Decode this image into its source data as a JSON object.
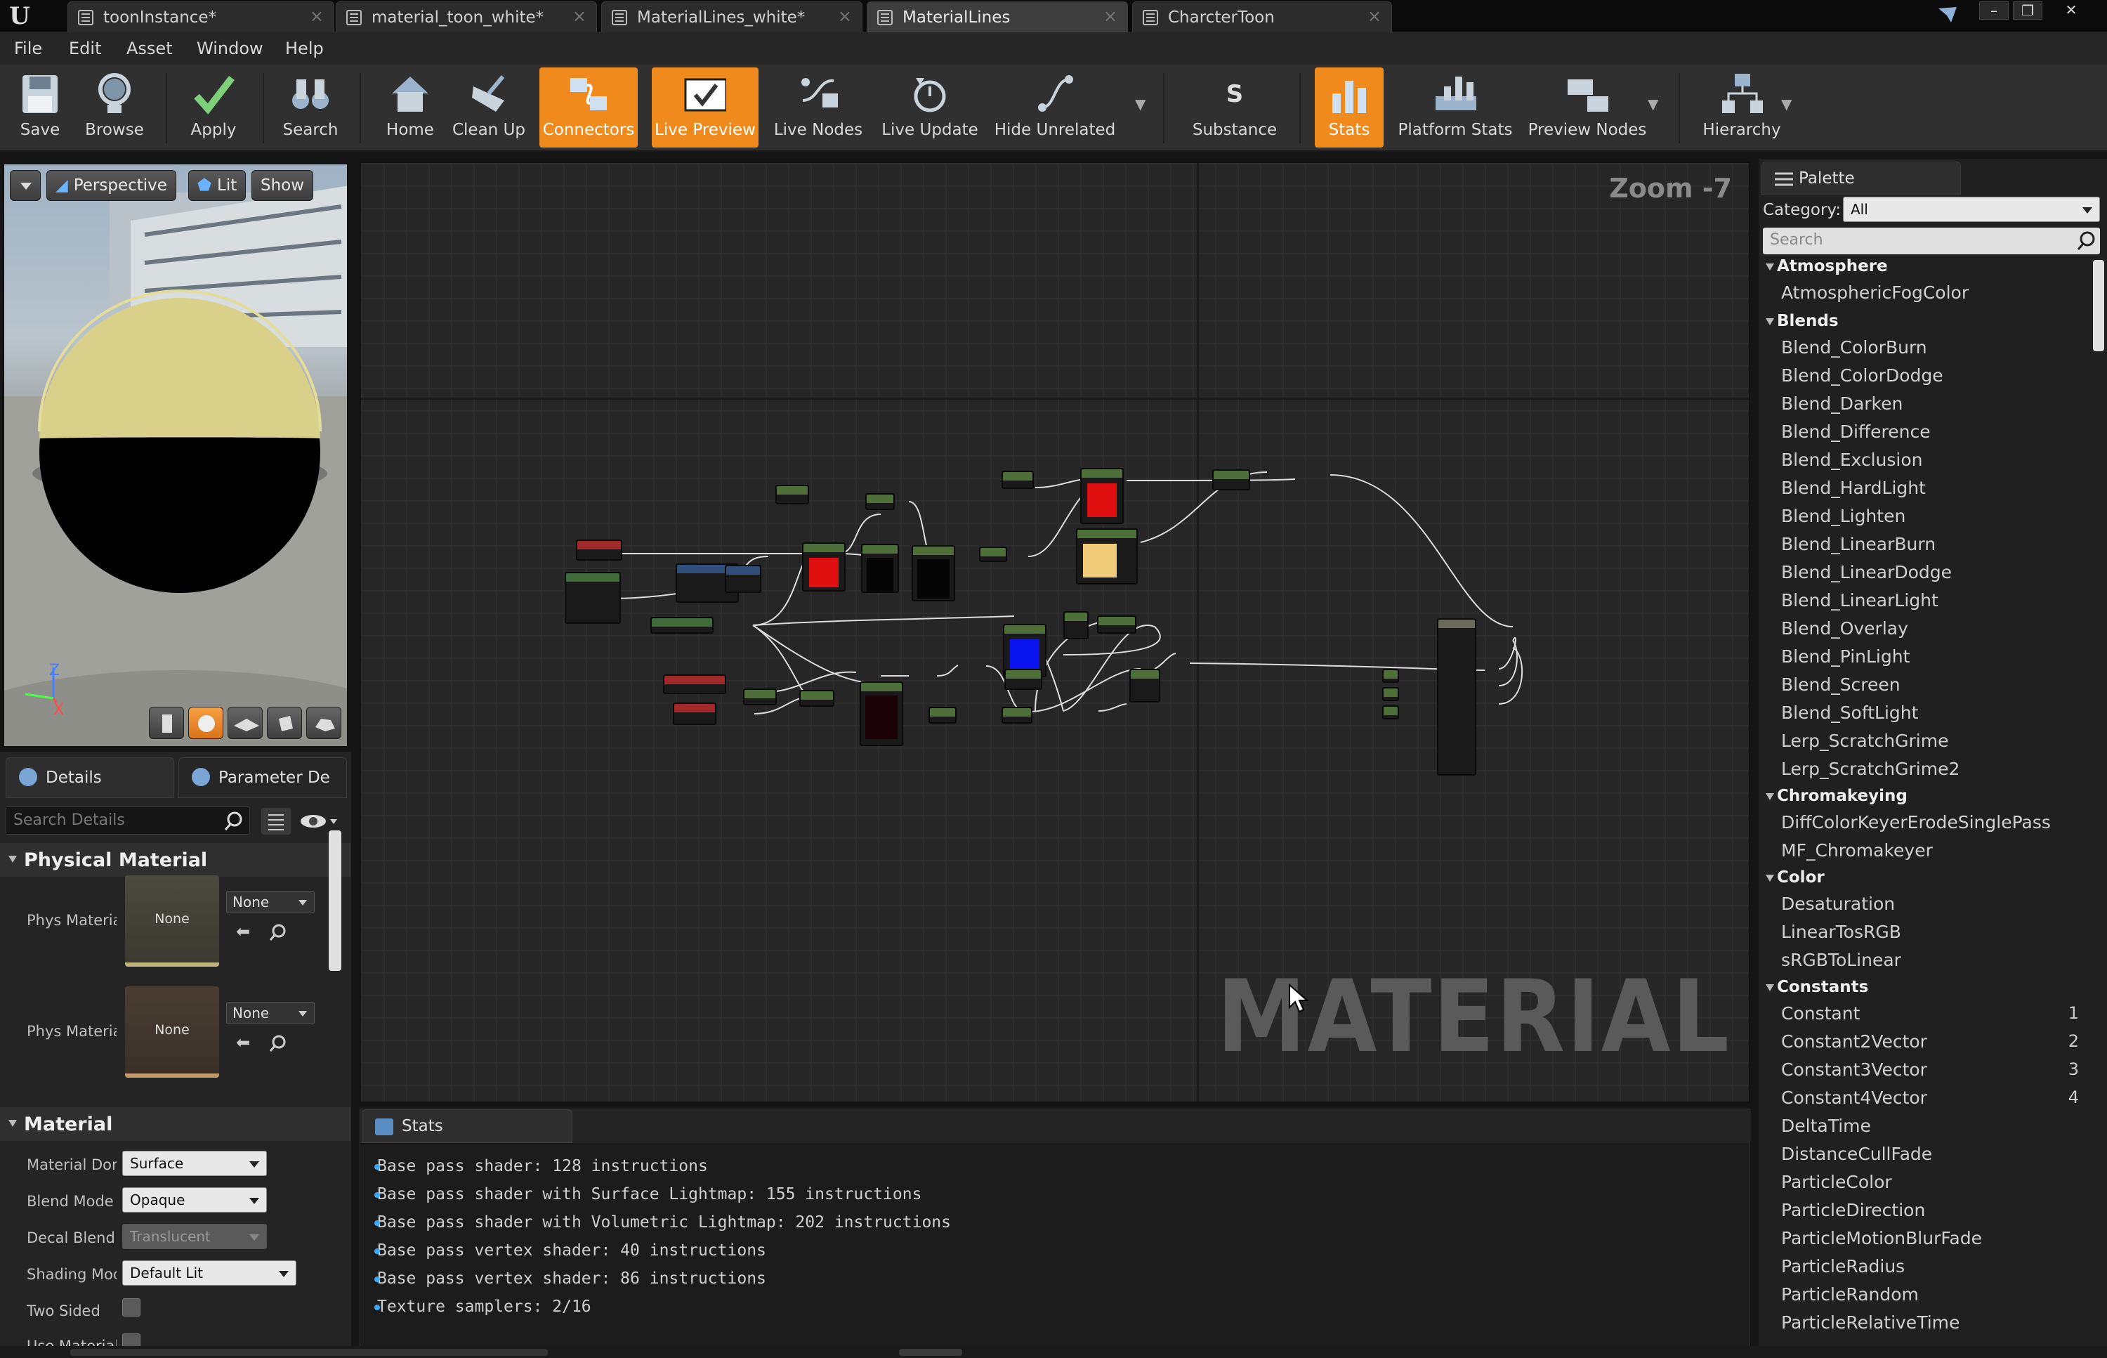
{
  "window": {
    "tabs": [
      {
        "label": "toonInstance*"
      },
      {
        "label": "material_toon_white*"
      },
      {
        "label": "MaterialLines_white*"
      },
      {
        "label": "MaterialLines"
      },
      {
        "label": "CharcterToon"
      }
    ]
  },
  "menu": [
    "File",
    "Edit",
    "Asset",
    "Window",
    "Help"
  ],
  "toolbar": {
    "save": "Save",
    "browse": "Browse",
    "apply": "Apply",
    "search": "Search",
    "home": "Home",
    "clean_up": "Clean Up",
    "connectors": "Connectors",
    "live_preview": "Live Preview",
    "live_nodes": "Live Nodes",
    "live_update": "Live Update",
    "hide_unrelated": "Hide Unrelated",
    "substance": "Substance",
    "stats": "Stats",
    "platform_stats": "Platform Stats",
    "preview_nodes": "Preview Nodes",
    "hierarchy": "Hierarchy",
    "accent": "#f08a1c"
  },
  "viewport": {
    "perspective": "Perspective",
    "lit": "Lit",
    "show": "Show",
    "axis_z": "Z",
    "axis_x": "X"
  },
  "details": {
    "tab_details": "Details",
    "tab_params": "Parameter De",
    "search_placeholder": "Search Details",
    "physical_material": {
      "title": "Physical Material",
      "rows": [
        {
          "label": "Phys Material",
          "swatch": "None",
          "value": "None"
        },
        {
          "label": "Phys Material",
          "swatch": "None",
          "value": "None"
        }
      ]
    },
    "material": {
      "title": "Material",
      "material_domain_label": "Material Dom",
      "material_domain": "Surface",
      "blend_mode_label": "Blend Mode",
      "blend_mode": "Opaque",
      "decal_blend_label": "Decal Blend M",
      "decal_blend": "Translucent",
      "shading_model_label": "Shading Mod",
      "shading_model": "Default Lit",
      "two_sided_label": "Two Sided",
      "use_material_label": "Use Material A"
    }
  },
  "graph": {
    "zoom": "Zoom -7",
    "watermark": "MATERIAL"
  },
  "stats": {
    "tab": "Stats",
    "lines": [
      "Base pass shader: 128 instructions",
      "Base pass shader with Surface Lightmap: 155 instructions",
      "Base pass shader with Volumetric Lightmap: 202 instructions",
      "Base pass vertex shader: 40 instructions",
      "Base pass vertex shader: 86 instructions",
      "Texture samplers: 2/16"
    ]
  },
  "palette": {
    "tab": "Palette",
    "category_label": "Category:",
    "category_value": "All",
    "search_placeholder": "Search",
    "groups": [
      {
        "name": "Atmosphere",
        "items": [
          "AtmosphericFogColor"
        ]
      },
      {
        "name": "Blends",
        "items": [
          "Blend_ColorBurn",
          "Blend_ColorDodge",
          "Blend_Darken",
          "Blend_Difference",
          "Blend_Exclusion",
          "Blend_HardLight",
          "Blend_Lighten",
          "Blend_LinearBurn",
          "Blend_LinearDodge",
          "Blend_LinearLight",
          "Blend_Overlay",
          "Blend_PinLight",
          "Blend_Screen",
          "Blend_SoftLight",
          "Lerp_ScratchGrime",
          "Lerp_ScratchGrime2"
        ]
      },
      {
        "name": "Chromakeying",
        "items": [
          "DiffColorKeyerErodeSinglePass",
          "MF_Chromakeyer"
        ]
      },
      {
        "name": "Color",
        "items": [
          "Desaturation",
          "LinearTosRGB",
          "sRGBToLinear"
        ]
      },
      {
        "name": "Constants",
        "items": [
          "Constant",
          "Constant2Vector",
          "Constant3Vector",
          "Constant4Vector",
          "DeltaTime",
          "DistanceCullFade",
          "ParticleColor",
          "ParticleDirection",
          "ParticleMotionBlurFade",
          "ParticleRadius",
          "ParticleRandom",
          "ParticleRelativeTime"
        ]
      }
    ],
    "hotkeys": {
      "Constant": "1",
      "Constant2Vector": "2",
      "Constant3Vector": "3",
      "Constant4Vector": "4"
    }
  }
}
